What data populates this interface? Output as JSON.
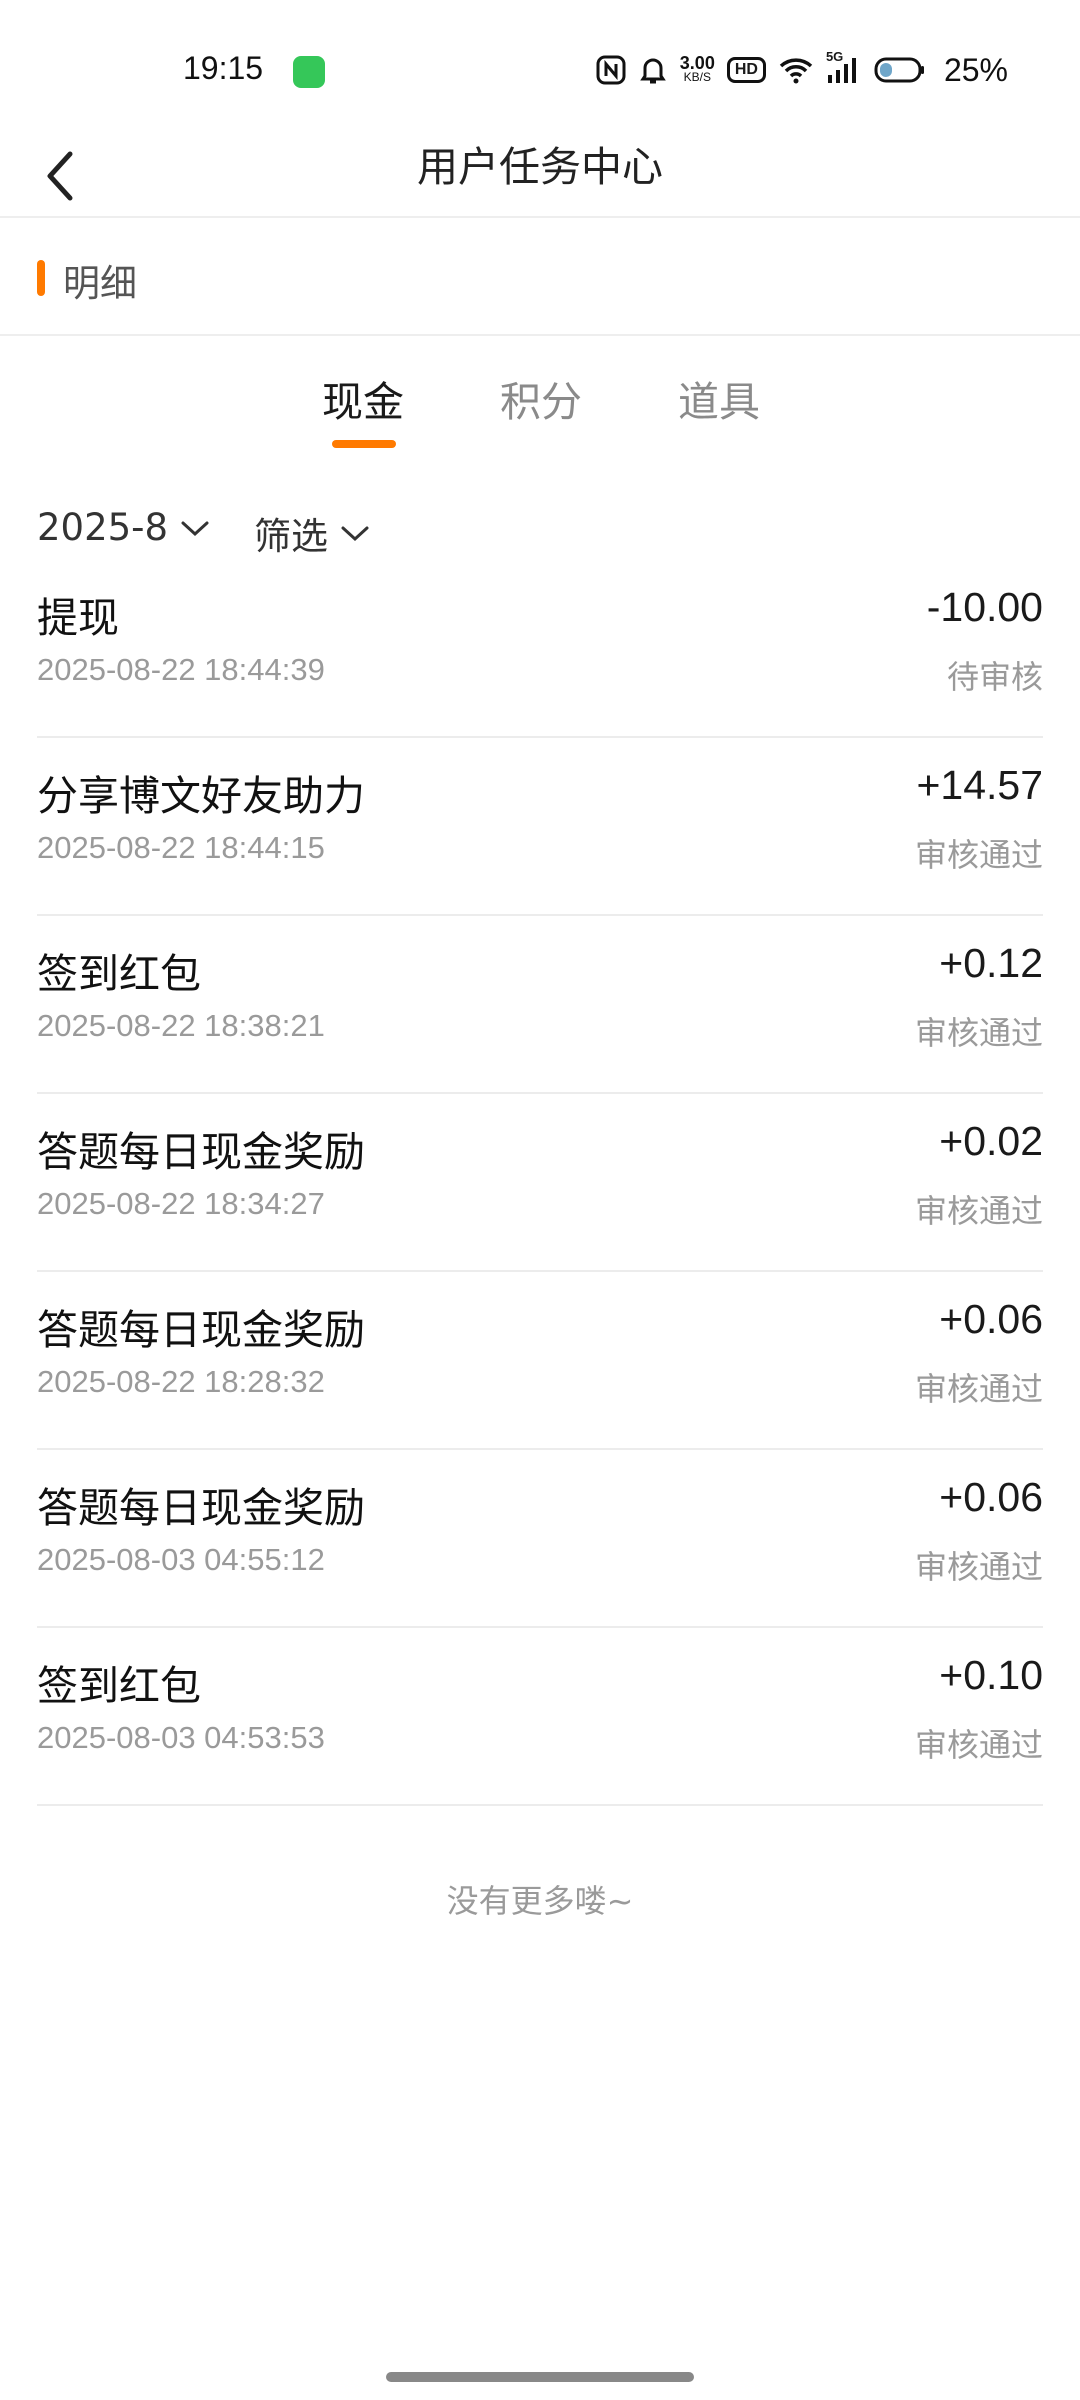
{
  "status_bar": {
    "time": "19:15",
    "net_speed": "3.00\nKB/S",
    "net_speed_top": "3.00",
    "net_speed_bottom": "KB/S",
    "hd_label": "HD",
    "signal_label": "5G",
    "battery_percent": "25%",
    "icons": [
      "message-app-icon",
      "nfc-icon",
      "silent-bell-icon",
      "hd-icon",
      "wifi-icon",
      "signal-5g-icon",
      "battery-icon"
    ]
  },
  "header": {
    "title": "用户任务中心",
    "back_icon": "chevron-left-icon"
  },
  "section": {
    "title": "明细",
    "accent_color": "#ff7a00"
  },
  "tabs": [
    {
      "label": "现金",
      "active": true
    },
    {
      "label": "积分",
      "active": false
    },
    {
      "label": "道具",
      "active": false
    }
  ],
  "filters": {
    "month": "2025-8",
    "filter_label": "筛选"
  },
  "transactions": [
    {
      "title": "提现",
      "time": "2025-08-22 18:44:39",
      "amount": "-10.00",
      "status": "待审核"
    },
    {
      "title": "分享博文好友助力",
      "time": "2025-08-22 18:44:15",
      "amount": "+14.57",
      "status": "审核通过"
    },
    {
      "title": "签到红包",
      "time": "2025-08-22 18:38:21",
      "amount": "+0.12",
      "status": "审核通过"
    },
    {
      "title": "答题每日现金奖励",
      "time": "2025-08-22 18:34:27",
      "amount": "+0.02",
      "status": "审核通过"
    },
    {
      "title": "答题每日现金奖励",
      "time": "2025-08-22 18:28:32",
      "amount": "+0.06",
      "status": "审核通过"
    },
    {
      "title": "答题每日现金奖励",
      "time": "2025-08-03 04:55:12",
      "amount": "+0.06",
      "status": "审核通过"
    },
    {
      "title": "签到红包",
      "time": "2025-08-03 04:53:53",
      "amount": "+0.10",
      "status": "审核通过"
    }
  ],
  "footer": {
    "no_more": "没有更多喽~"
  }
}
